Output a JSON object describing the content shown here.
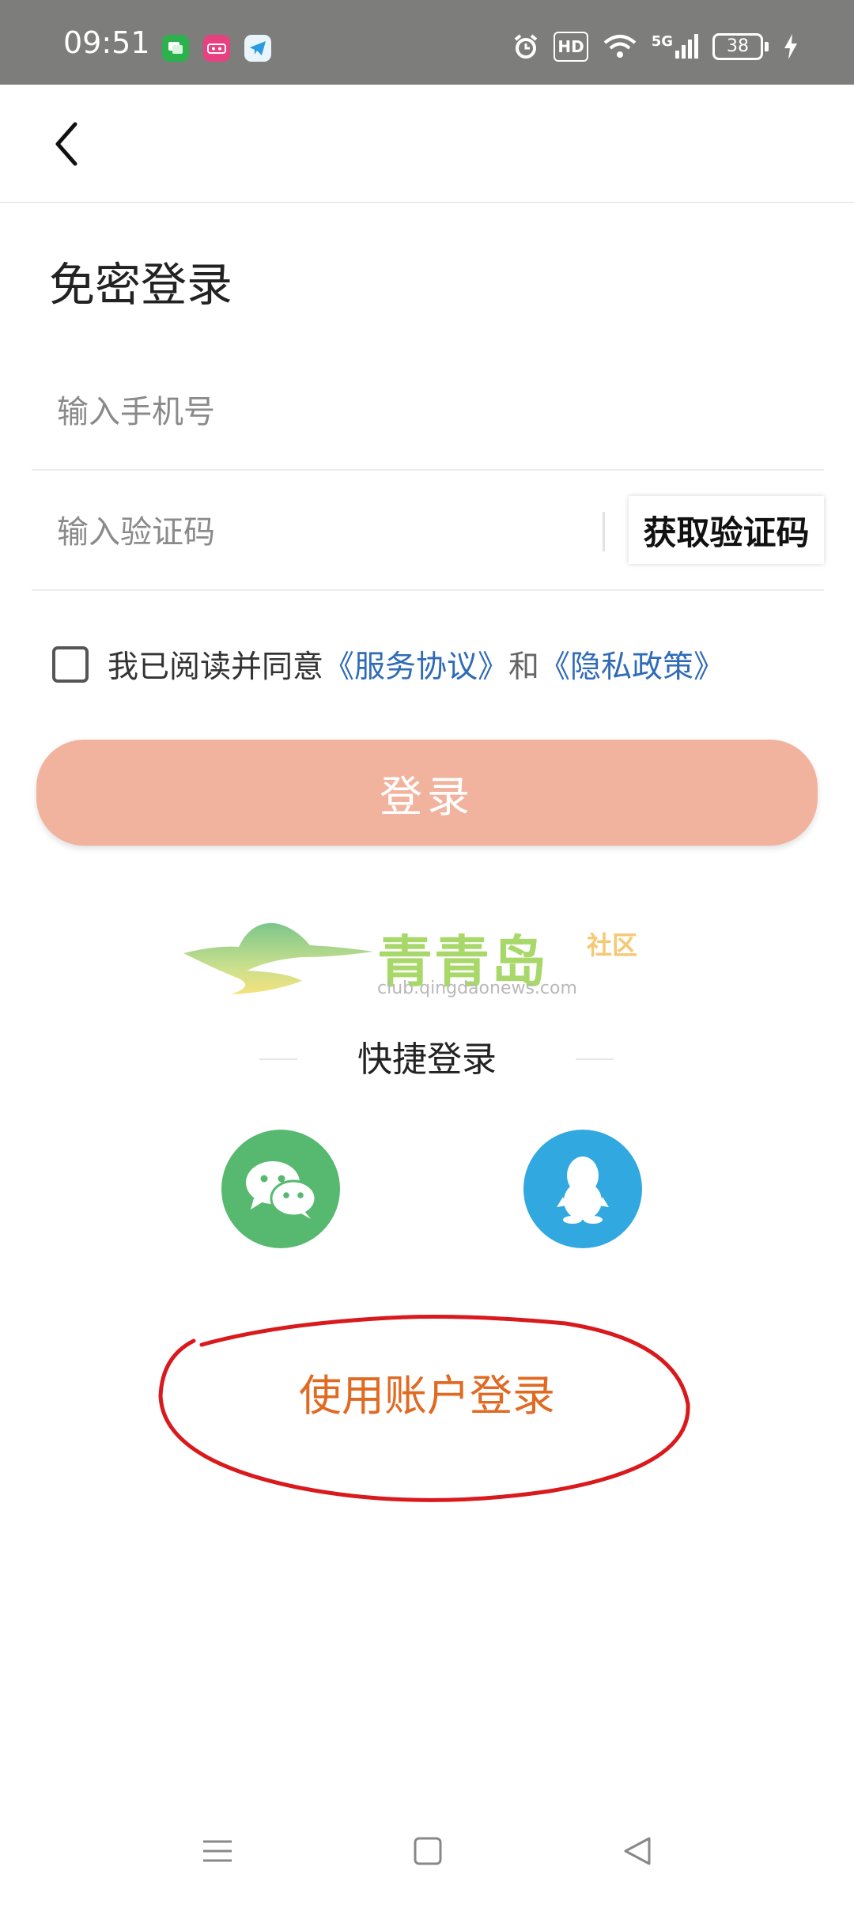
{
  "status_bar": {
    "time": "09:51",
    "battery": "38",
    "network": "5G",
    "hd": "HD"
  },
  "page": {
    "title": "免密登录"
  },
  "form": {
    "phone_placeholder": "输入手机号",
    "code_placeholder": "输入验证码",
    "get_code_label": "获取验证码"
  },
  "agreement": {
    "prefix": "我已阅读并同意",
    "service_link": "《服务协议》",
    "conjunction": "和",
    "privacy_link": "《隐私政策》"
  },
  "login_button": "登录",
  "logo": {
    "name": "青青岛",
    "tag": "社区",
    "url": "club.qingdaonews.com"
  },
  "quick_login": {
    "label": "快捷登录"
  },
  "account_login": "使用账户登录",
  "colors": {
    "login_button": "#f2b39e",
    "link": "#2f6bb7",
    "account_login": "#e06a22",
    "wechat": "#56b96f",
    "qq": "#31a8df",
    "annotation": "#d9191c"
  }
}
